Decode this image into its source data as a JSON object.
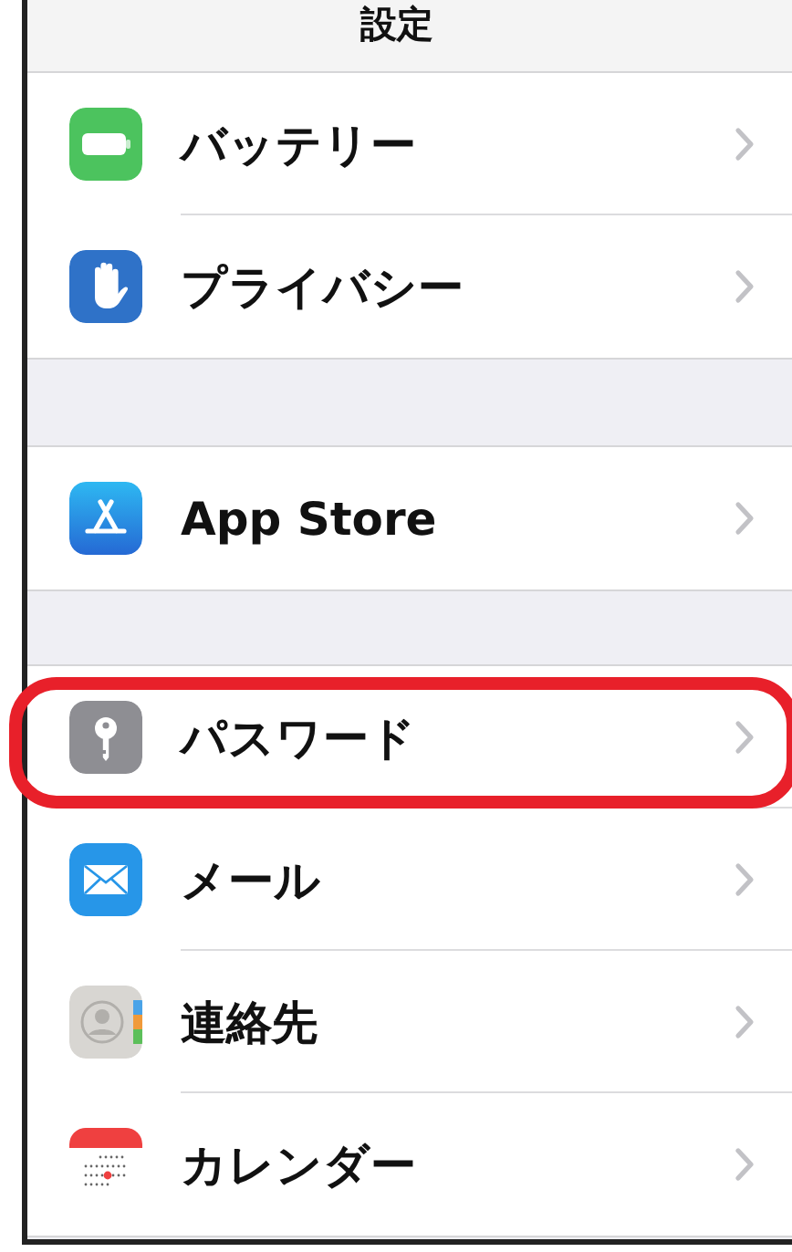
{
  "header": {
    "title": "設定"
  },
  "groups": [
    {
      "items": [
        {
          "label": "バッテリー",
          "kind": "battery",
          "highlighted": false
        },
        {
          "label": "プライバシー",
          "kind": "hand",
          "highlighted": false
        }
      ]
    },
    {
      "items": [
        {
          "label": "App Store",
          "kind": "appstore",
          "highlighted": false
        }
      ]
    },
    {
      "items": [
        {
          "label": "パスワード",
          "kind": "key",
          "highlighted": true
        },
        {
          "label": "メール",
          "kind": "mail",
          "highlighted": false
        },
        {
          "label": "連絡先",
          "kind": "contacts",
          "highlighted": false
        },
        {
          "label": "カレンダー",
          "kind": "calendar",
          "highlighted": false
        }
      ]
    }
  ]
}
